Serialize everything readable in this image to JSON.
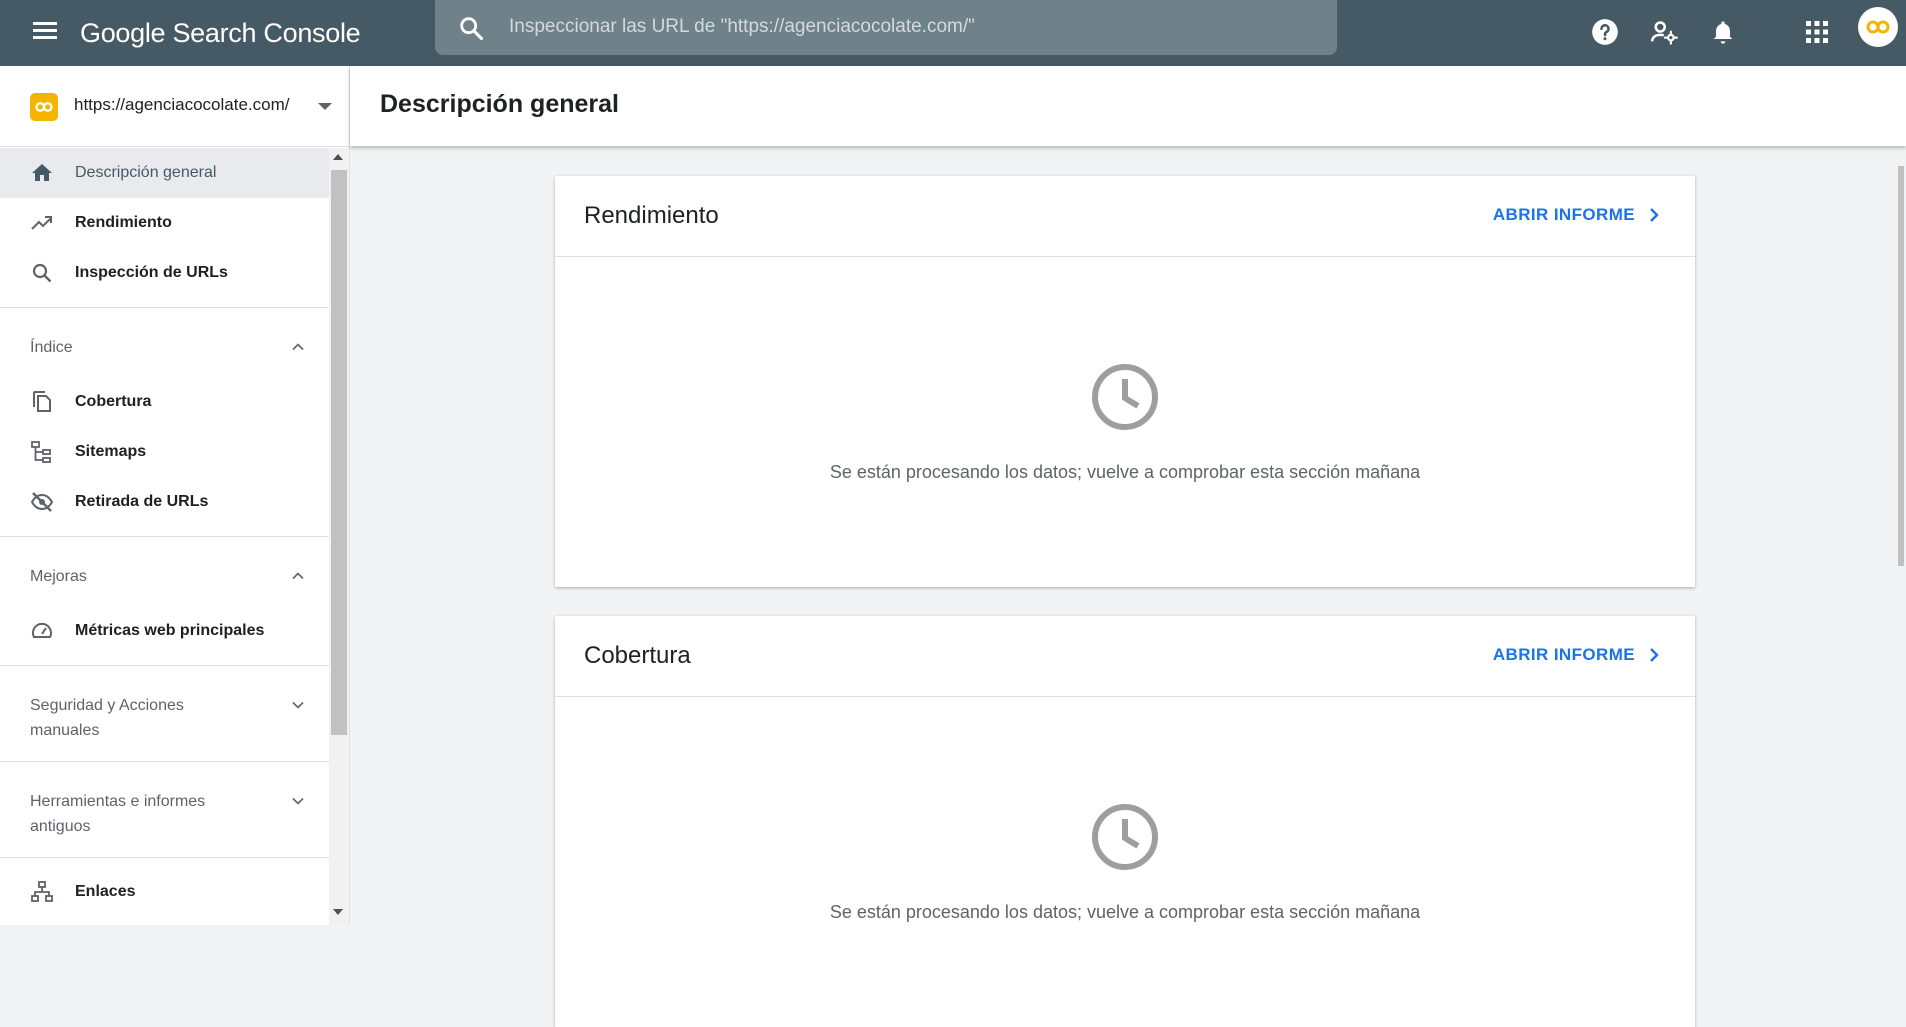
{
  "app": {
    "title": "Google Search Console",
    "search_placeholder": "Inspeccionar las URL de \"https://agenciacocolate.com/\""
  },
  "topbar_icons": [
    "help-icon",
    "manage-users-icon",
    "notifications-icon",
    "apps-grid-icon"
  ],
  "colors": {
    "topbar": "#455a64",
    "accent_link": "#1a73e8",
    "brand_yellow": "#f4b400"
  },
  "property": {
    "url": "https://agenciacocolate.com/"
  },
  "sidebar": {
    "items": [
      {
        "label": "Descripción general",
        "icon": "home-icon",
        "active": true
      },
      {
        "label": "Rendimiento",
        "icon": "trending-up-icon"
      },
      {
        "label": "Inspección de URLs",
        "icon": "search-icon"
      }
    ],
    "sections": [
      {
        "label": "Índice",
        "expanded": true,
        "items": [
          {
            "label": "Cobertura",
            "icon": "copy-icon"
          },
          {
            "label": "Sitemaps",
            "icon": "sitemap-icon"
          },
          {
            "label": "Retirada de URLs",
            "icon": "visibility-off-icon"
          }
        ]
      },
      {
        "label": "Mejoras",
        "expanded": true,
        "items": [
          {
            "label": "Métricas web principales",
            "icon": "speed-gauge-icon"
          }
        ]
      },
      {
        "label": "Seguridad y Acciones manuales",
        "expanded": false
      },
      {
        "label": "Herramientas e informes antiguos",
        "expanded": false
      }
    ],
    "bottom_items": [
      {
        "label": "Enlaces",
        "icon": "links-hierarchy-icon"
      }
    ]
  },
  "main": {
    "page_title": "Descripción general",
    "cards": [
      {
        "title": "Rendimiento",
        "link_label": "ABRIR INFORME",
        "message": "Se están procesando los datos; vuelve a comprobar esta sección mañana"
      },
      {
        "title": "Cobertura",
        "link_label": "ABRIR INFORME",
        "message": "Se están procesando los datos; vuelve a comprobar esta sección mañana"
      }
    ]
  }
}
